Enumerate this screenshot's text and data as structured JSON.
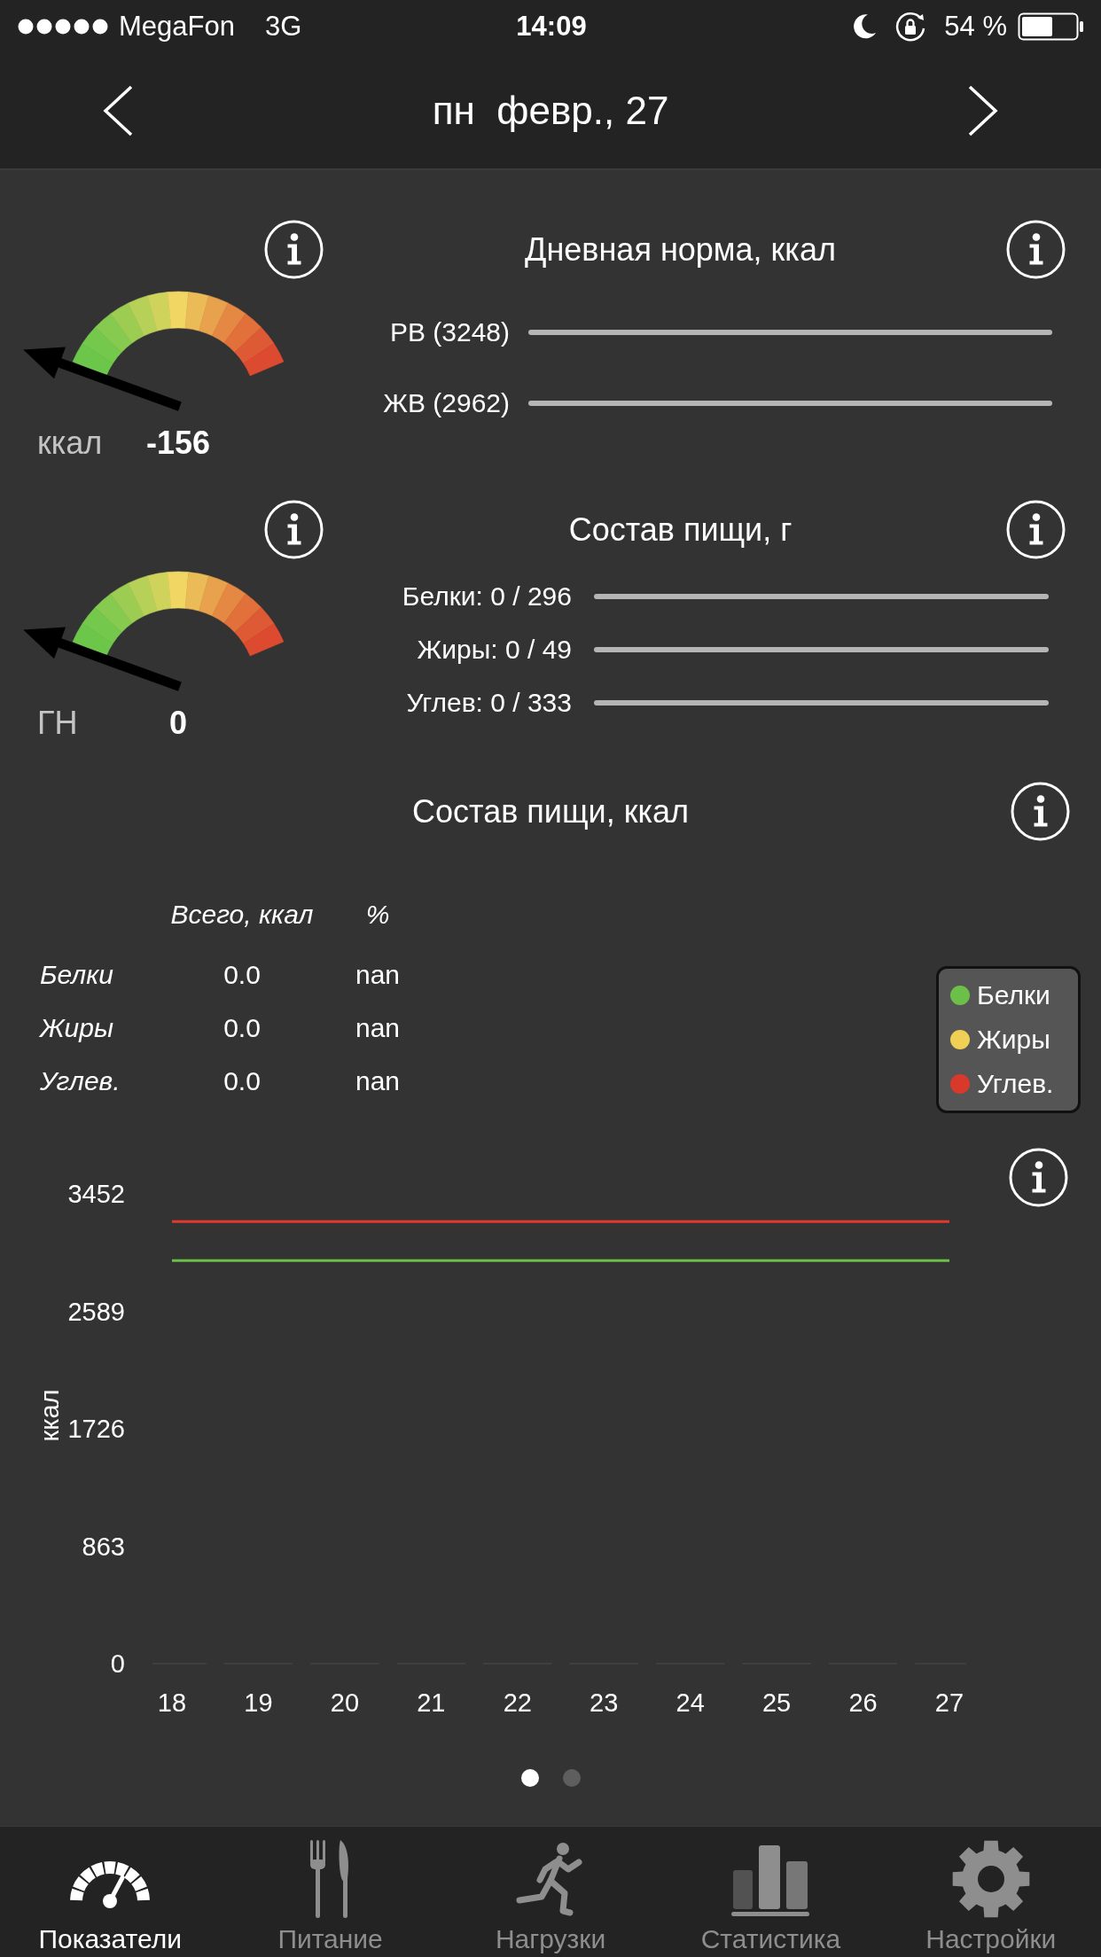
{
  "status_bar": {
    "carrier": "MegaFon",
    "network": "3G",
    "time": "14:09",
    "battery": "54 %"
  },
  "navbar": {
    "title": "пн  февр., 27"
  },
  "daily_norm": {
    "gauge": {
      "unit": "ккал",
      "value": "-156"
    },
    "title": "Дневная норма, ккал",
    "bars": [
      {
        "label": "РВ (3248)"
      },
      {
        "label": "ЖВ (2962)"
      }
    ]
  },
  "food_composition_g": {
    "gauge": {
      "unit": "ГН",
      "value": "0"
    },
    "title": "Состав пищи, г",
    "bars": [
      {
        "label": "Белки: 0 / 296"
      },
      {
        "label": "Жиры: 0 / 49"
      },
      {
        "label": "Углев: 0 / 333"
      }
    ]
  },
  "food_composition_kcal": {
    "title": "Состав пищи, ккал",
    "table": {
      "columns": [
        "",
        "Всего, ккал",
        "%"
      ],
      "rows": [
        [
          "Белки",
          "0.0",
          "nan"
        ],
        [
          "Жиры",
          "0.0",
          "nan"
        ],
        [
          "Углев.",
          "0.0",
          "nan"
        ]
      ]
    },
    "chart_data": {
      "type": "bar",
      "ylabel": "ккал",
      "categories": [
        "18",
        "19",
        "20",
        "21",
        "22",
        "23",
        "24",
        "25",
        "26",
        "27"
      ],
      "ylim": [
        0,
        3452
      ],
      "yticks": [
        0,
        863,
        1726,
        2589,
        3452
      ],
      "series": [
        {
          "name": "Белки",
          "color": "#6cc04a",
          "values": [
            0,
            0,
            0,
            0,
            0,
            0,
            0,
            0,
            0,
            0
          ]
        },
        {
          "name": "Жиры",
          "color": "#f0cf55",
          "values": [
            0,
            0,
            0,
            0,
            0,
            0,
            0,
            0,
            0,
            0
          ]
        },
        {
          "name": "Углев.",
          "color": "#d9392b",
          "values": [
            0,
            0,
            0,
            0,
            0,
            0,
            0,
            0,
            0,
            0
          ]
        }
      ],
      "ref_lines": [
        {
          "axis": "y",
          "value": 3248,
          "color": "#e2392c"
        },
        {
          "axis": "y",
          "value": 2962,
          "color": "#6cc04a"
        }
      ]
    }
  },
  "pager": [
    {
      "selected": true
    },
    {
      "selected": false
    }
  ],
  "tab_bar": [
    {
      "label": "Показатели",
      "selected": true
    },
    {
      "label": "Питание",
      "selected": false
    },
    {
      "label": "Нагрузки",
      "selected": false
    },
    {
      "label": "Статистика",
      "selected": false
    },
    {
      "label": "Настройки",
      "selected": false
    }
  ]
}
